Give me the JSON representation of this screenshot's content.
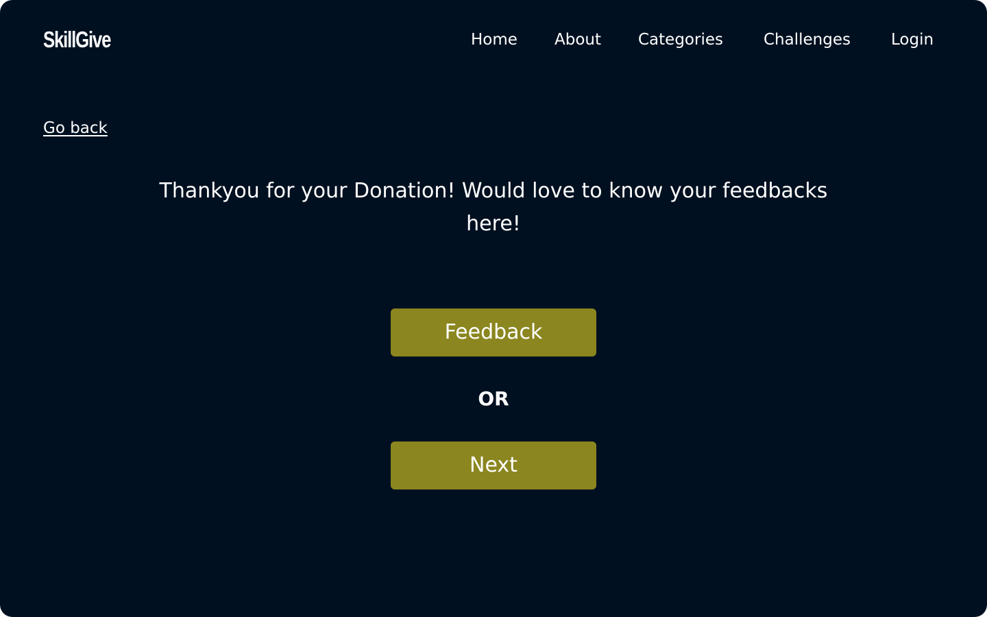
{
  "header": {
    "logo": "SkillGive",
    "nav": [
      "Home",
      "About",
      "Categories",
      "Challenges",
      "Login"
    ]
  },
  "go_back": "Go back",
  "message": "Thankyou for your Donation! Would love to know your feedbacks here!",
  "feedback_button": "Feedback",
  "separator": "OR",
  "next_button": "Next",
  "colors": {
    "background": "#001020",
    "button": "#8b8620",
    "text": "#ffffff"
  }
}
